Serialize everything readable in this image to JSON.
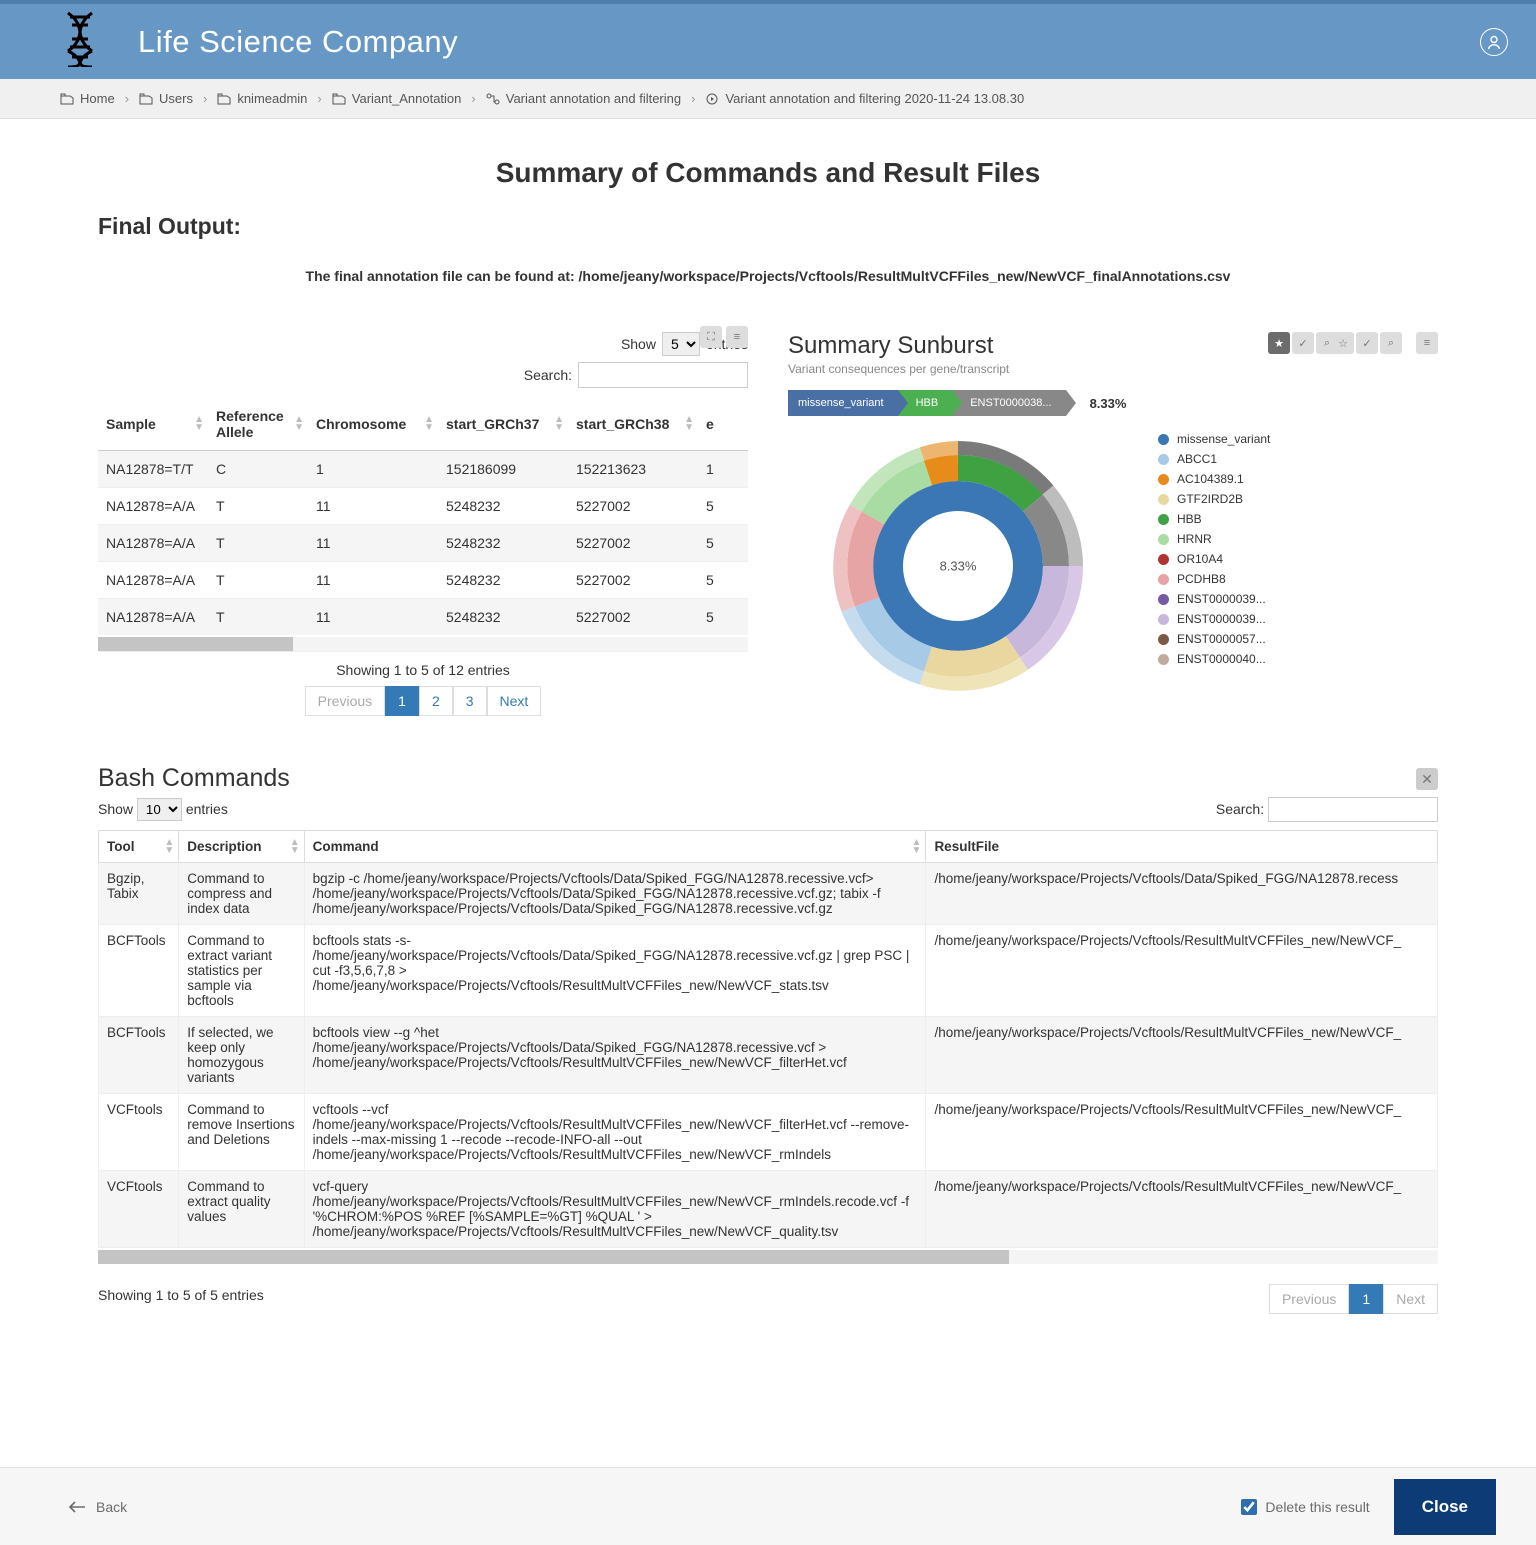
{
  "brand": {
    "title": "Life Science Company"
  },
  "breadcrumb": {
    "items": [
      "Home",
      "Users",
      "knimeadmin",
      "Variant_Annotation",
      "Variant annotation and filtering",
      "Variant annotation and filtering 2020-11-24 13.08.30"
    ]
  },
  "page": {
    "title": "Summary of Commands and Result Files",
    "final_output_heading": "Final Output:",
    "final_path_label": "The final annotation file can be found at: /home/jeany/workspace/Projects/Vcftools/ResultMultVCFFiles_new/NewVCF_finalAnnotations.csv"
  },
  "table1": {
    "show_label": "Show",
    "entries_label": "entries",
    "entries_select": "5",
    "search_label": "Search:",
    "search_value": "",
    "columns": [
      "Sample",
      "Reference Allele",
      "Chromosome",
      "start_GRCh37",
      "start_GRCh38",
      "e"
    ],
    "rows": [
      {
        "c": [
          "NA12878=T/T",
          "C",
          "1",
          "152186099",
          "152213623",
          "1"
        ]
      },
      {
        "c": [
          "NA12878=A/A",
          "T",
          "11",
          "5248232",
          "5227002",
          "5"
        ]
      },
      {
        "c": [
          "NA12878=A/A",
          "T",
          "11",
          "5248232",
          "5227002",
          "5"
        ]
      },
      {
        "c": [
          "NA12878=A/A",
          "T",
          "11",
          "5248232",
          "5227002",
          "5"
        ]
      },
      {
        "c": [
          "NA12878=A/A",
          "T",
          "11",
          "5248232",
          "5227002",
          "5"
        ]
      }
    ],
    "info": "Showing 1 to 5 of 12 entries",
    "pages": {
      "prev": "Previous",
      "p1": "1",
      "p2": "2",
      "p3": "3",
      "next": "Next"
    }
  },
  "sunburst": {
    "title": "Summary Sunburst",
    "subtitle": "Variant consequences per gene/transcript",
    "path": [
      "missense_variant",
      "HBB",
      "ENST0000038..."
    ],
    "pct": "8.33%",
    "center_label": "8.33%",
    "legend": [
      {
        "color": "#3b77b5",
        "label": "missense_variant"
      },
      {
        "color": "#a7cbe6",
        "label": "ABCC1"
      },
      {
        "color": "#e78c1a",
        "label": "AC104389.1"
      },
      {
        "color": "#e9d79f",
        "label": "GTF2IRD2B"
      },
      {
        "color": "#3fa142",
        "label": "HBB"
      },
      {
        "color": "#a9dca2",
        "label": "HRNR"
      },
      {
        "color": "#b33232",
        "label": "OR10A4"
      },
      {
        "color": "#e6a4a4",
        "label": "PCDHB8"
      },
      {
        "color": "#7859a6",
        "label": "ENST0000039..."
      },
      {
        "color": "#c6b7db",
        "label": "ENST0000039..."
      },
      {
        "color": "#7a5a47",
        "label": "ENST0000057..."
      },
      {
        "color": "#c2ab9b",
        "label": "ENST0000040..."
      }
    ]
  },
  "bash": {
    "heading": "Bash Commands",
    "show_label": "Show",
    "entries_label": "entries",
    "entries_select": "10",
    "search_label": "Search:",
    "search_value": "",
    "columns": [
      "Tool",
      "Description",
      "Command",
      "ResultFile"
    ],
    "rows": [
      {
        "tool": "Bgzip, Tabix",
        "desc": "Command to compress and index data",
        "cmd": "bgzip -c /home/jeany/workspace/Projects/Vcftools/Data/Spiked_FGG/NA12878.recessive.vcf> /home/jeany/workspace/Projects/Vcftools/Data/Spiked_FGG/NA12878.recessive.vcf.gz; tabix -f /home/jeany/workspace/Projects/Vcftools/Data/Spiked_FGG/NA12878.recessive.vcf.gz",
        "res": "/home/jeany/workspace/Projects/Vcftools/Data/Spiked_FGG/NA12878.recess"
      },
      {
        "tool": "BCFTools",
        "desc": "Command to extract variant statistics per sample via bcftools",
        "cmd": "bcftools stats -s- /home/jeany/workspace/Projects/Vcftools/Data/Spiked_FGG/NA12878.recessive.vcf.gz | grep PSC | cut -f3,5,6,7,8 > /home/jeany/workspace/Projects/Vcftools/ResultMultVCFFiles_new/NewVCF_stats.tsv",
        "res": "/home/jeany/workspace/Projects/Vcftools/ResultMultVCFFiles_new/NewVCF_"
      },
      {
        "tool": "BCFTools",
        "desc": "If selected, we keep only homozygous variants",
        "cmd": "bcftools view --g ^het /home/jeany/workspace/Projects/Vcftools/Data/Spiked_FGG/NA12878.recessive.vcf > /home/jeany/workspace/Projects/Vcftools/ResultMultVCFFiles_new/NewVCF_filterHet.vcf",
        "res": "/home/jeany/workspace/Projects/Vcftools/ResultMultVCFFiles_new/NewVCF_"
      },
      {
        "tool": "VCFtools",
        "desc": "Command to remove Insertions and Deletions",
        "cmd": "vcftools --vcf /home/jeany/workspace/Projects/Vcftools/ResultMultVCFFiles_new/NewVCF_filterHet.vcf --remove-indels --max-missing 1 --recode --recode-INFO-all --out /home/jeany/workspace/Projects/Vcftools/ResultMultVCFFiles_new/NewVCF_rmIndels",
        "res": "/home/jeany/workspace/Projects/Vcftools/ResultMultVCFFiles_new/NewVCF_"
      },
      {
        "tool": "VCFtools",
        "desc": "Command to extract quality values",
        "cmd": "vcf-query /home/jeany/workspace/Projects/Vcftools/ResultMultVCFFiles_new/NewVCF_rmIndels.recode.vcf -f '%CHROM:%POS %REF [%SAMPLE=%GT] %QUAL ' > /home/jeany/workspace/Projects/Vcftools/ResultMultVCFFiles_new/NewVCF_quality.tsv",
        "res": "/home/jeany/workspace/Projects/Vcftools/ResultMultVCFFiles_new/NewVCF_"
      }
    ],
    "info": "Showing 1 to 5 of 5 entries",
    "pages": {
      "prev": "Previous",
      "p1": "1",
      "next": "Next"
    }
  },
  "footer": {
    "back": "Back",
    "delete_label": "Delete this result",
    "close": "Close"
  }
}
